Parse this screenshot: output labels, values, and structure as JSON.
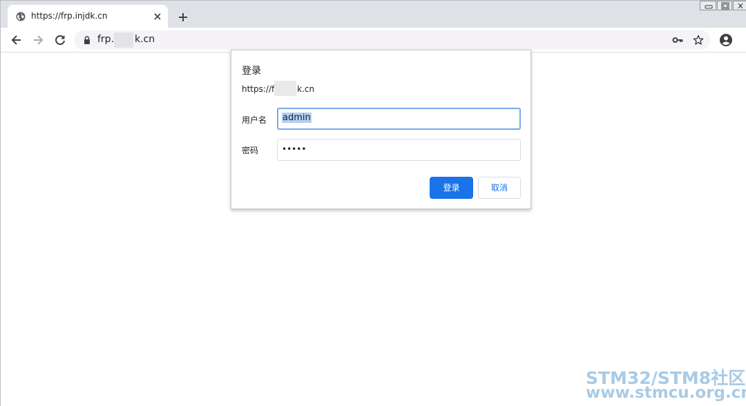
{
  "browser": {
    "tab": {
      "title": "https://frp.injdk.cn"
    },
    "address_bar": {
      "url_prefix": "frp.",
      "url_suffix": "k.cn"
    }
  },
  "dialog": {
    "title": "登录",
    "origin_prefix": "https://fr",
    "origin_suffix": "k.cn",
    "username_label": "用户名",
    "username_value": "admin",
    "password_label": "密码",
    "password_value": "•••••",
    "login_button": "登录",
    "cancel_button": "取消"
  },
  "watermark": {
    "line1": "STM32/STM8社区",
    "line2": "www.stmcu.org.cn"
  },
  "colors": {
    "accent": "#1a73e8",
    "focus_ring": "#7aa7ea",
    "selection": "#b3cff5"
  },
  "icons": [
    "globe-icon",
    "tab-close-icon",
    "new-tab-icon",
    "back-icon",
    "forward-icon",
    "reload-icon",
    "lock-icon",
    "key-icon",
    "star-icon",
    "profile-icon"
  ]
}
